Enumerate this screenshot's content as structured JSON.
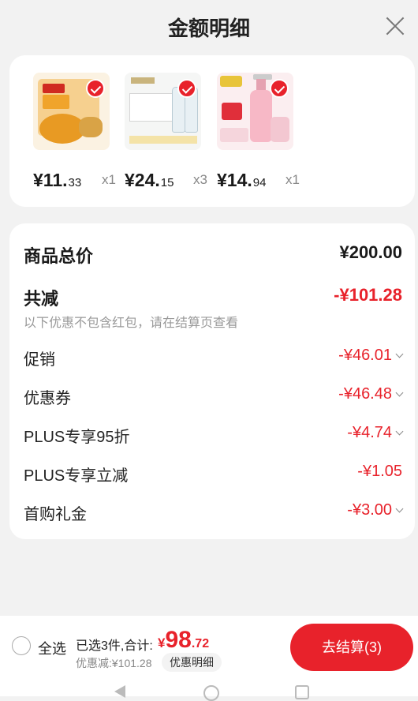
{
  "header": {
    "title": "金额明细"
  },
  "products": [
    {
      "price_int": "¥11.",
      "price_dec": "33",
      "qty": "x1"
    },
    {
      "price_int": "¥24.",
      "price_dec": "15",
      "qty": "x3"
    },
    {
      "price_int": "¥14.",
      "price_dec": "94",
      "qty": "x1"
    }
  ],
  "summary": {
    "total_label": "商品总价",
    "total_value": "¥200.00",
    "reduce_label": "共减",
    "reduce_value": "-¥101.28",
    "reduce_note": "以下优惠不包含红包，请在结算页查看",
    "items": [
      {
        "label": "促销",
        "value": "-¥46.01"
      },
      {
        "label": "优惠券",
        "value": "-¥46.48"
      },
      {
        "label": "PLUS专享95折",
        "value": "-¥4.74"
      },
      {
        "label": "PLUS专享立减",
        "value": "-¥1.05"
      },
      {
        "label": "首购礼金",
        "value": "-¥3.00"
      }
    ]
  },
  "bottom": {
    "select_all": "全选",
    "selected_info": "已选3件,合计:",
    "total_yen": "¥",
    "total_int": "98",
    "total_dec": ".72",
    "discount": "优惠减:¥101.28",
    "detail_button": "优惠明细",
    "checkout_button": "去结算(3)"
  },
  "colors": {
    "accent": "#e8222b",
    "background": "#f2f2f2"
  }
}
